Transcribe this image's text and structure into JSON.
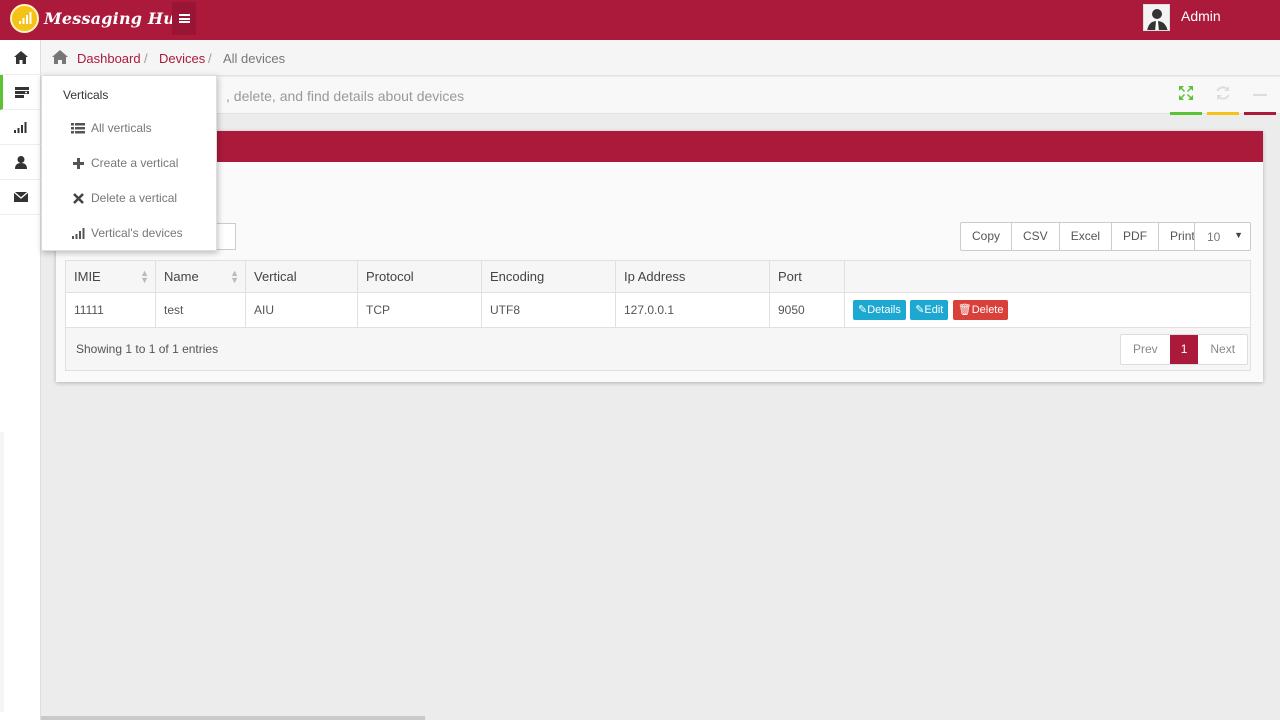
{
  "app": {
    "brand": "Messaging Hub",
    "user_name": "Admin"
  },
  "colors": {
    "primary": "#ab1a3b",
    "accent_green": "#5bc236",
    "accent_yellow": "#f5c218",
    "info": "#1ca8d1",
    "danger": "#d9403a"
  },
  "breadcrumb": {
    "home_icon": "home-icon",
    "items": [
      "Dashboard",
      "Devices",
      "All devices"
    ],
    "separator": "/"
  },
  "page": {
    "description": ", delete, and find details about devices"
  },
  "rail_icons": [
    "home-icon",
    "server-icon",
    "signal-icon",
    "user-icon",
    "envelope-icon"
  ],
  "flyout": {
    "title": "Verticals",
    "items": [
      {
        "label": "All verticals",
        "icon": "list-icon"
      },
      {
        "label": "Create a vertical",
        "icon": "plus-icon"
      },
      {
        "label": "Delete a vertical",
        "icon": "times-icon"
      },
      {
        "label": "Vertical's devices",
        "icon": "signal-icon"
      }
    ]
  },
  "toolbar": {
    "buttons": [
      "Copy",
      "CSV",
      "Excel",
      "PDF",
      "Print"
    ],
    "page_length": "10"
  },
  "table": {
    "columns": [
      "IMIE",
      "Name",
      "Vertical",
      "Protocol",
      "Encoding",
      "Ip Address",
      "Port",
      ""
    ],
    "rows": [
      {
        "imie": "11111",
        "name": "test",
        "vertical": "AIU",
        "protocol": "TCP",
        "encoding": "UTF8",
        "ip": "127.0.0.1",
        "port": "9050"
      }
    ],
    "row_actions": [
      "Details",
      "Edit",
      "Delete"
    ]
  },
  "footer": {
    "info": "Showing 1 to 1 of 1 entries",
    "prev": "Prev",
    "current_page": "1",
    "next": "Next"
  }
}
